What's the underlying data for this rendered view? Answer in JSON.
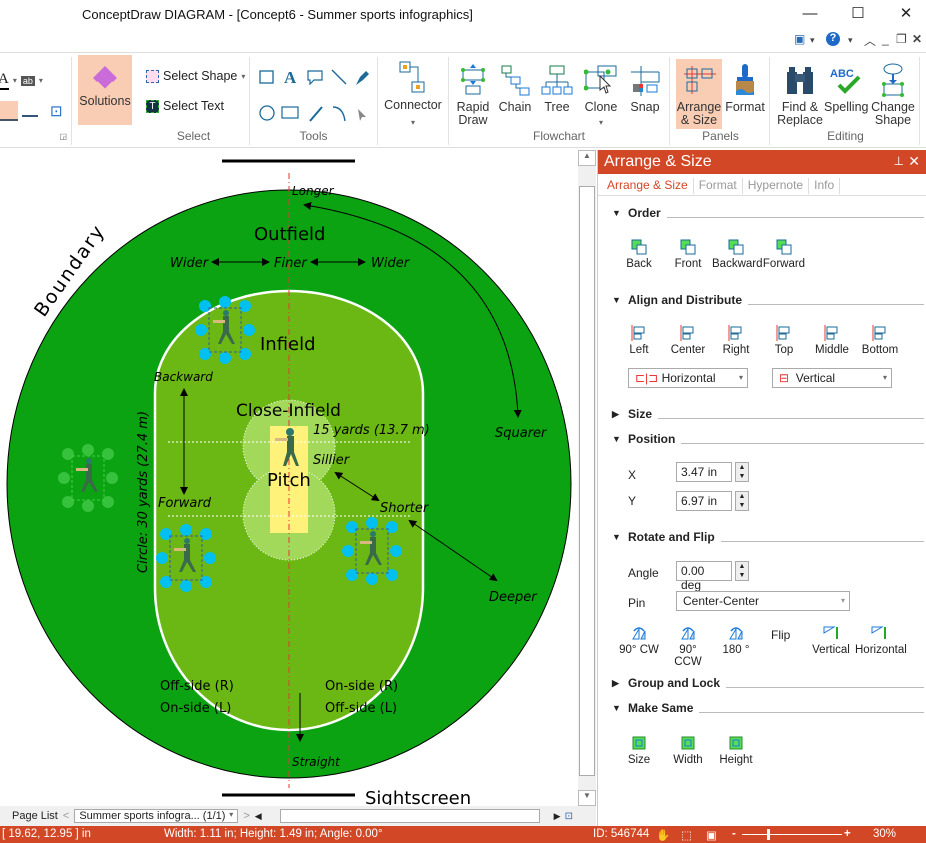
{
  "window": {
    "title": "ConceptDraw DIAGRAM - [Concept6 - Summer sports infographics]",
    "minimize": "—",
    "maximize": "☐",
    "close": "✕"
  },
  "mdi": {
    "layout_icon": "▣",
    "help_icon": "?",
    "collapse": "︿",
    "min": "_",
    "restore": "❐",
    "close": "✕",
    "dropdown": "▾"
  },
  "ribbon": {
    "format_small": {
      "font_color": "A",
      "highlight": "ab"
    },
    "solutions": {
      "label": "Solutions"
    },
    "select": {
      "select_shape": "Select Shape",
      "select_text": "Select Text",
      "group": "Select"
    },
    "tools": {
      "group": "Tools"
    },
    "connector": {
      "label": "Connector"
    },
    "flowchart": {
      "group": "Flowchart",
      "items": [
        {
          "label": "Rapid\nDraw"
        },
        {
          "label": "Chain"
        },
        {
          "label": "Tree"
        },
        {
          "label": "Clone"
        },
        {
          "label": "Snap"
        }
      ]
    },
    "panels": {
      "group": "Panels",
      "arrange": "Arrange\n& Size",
      "format": "Format"
    },
    "editing": {
      "group": "Editing",
      "find": "Find &\nReplace",
      "spelling": "Spelling",
      "change": "Change\nShape"
    }
  },
  "canvas": {
    "labels": {
      "boundary": "Boundary",
      "outfield": "Outfield",
      "infield": "Infield",
      "close_infield": "Close-Infield",
      "pitch": "Pitch",
      "longer": "Longer",
      "wider_left": "Wider",
      "finer": "Finer",
      "wider_right": "Wider",
      "squarer": "Squarer",
      "backward": "Backward",
      "forward": "Forward",
      "fifteen": "15 yards (13.7 m)",
      "sillier": "Sillier",
      "shorter": "Shorter",
      "deeper": "Deeper",
      "circle": "Circle: 30 yards (27.4 m)",
      "offside_r": "Off-side (R)",
      "onside_l": "On-side (L)",
      "onside_r": "On-side (R)",
      "offside_l": "Off-side (L)",
      "straight": "Straight",
      "sightscreen": "Sightscreen"
    },
    "colors": {
      "outfield": "#0ba312",
      "infield": "#6bb814",
      "close": "#a3d95a",
      "pitch": "#fff27a",
      "handle": "#00c0f0"
    }
  },
  "pagelist": {
    "label": "Page List",
    "page": "Summer sports infogra... (1/1)"
  },
  "panel": {
    "title": "Arrange & Size",
    "pin": "📌",
    "close": "✕",
    "tabs": [
      "Arrange & Size",
      "Format",
      "Hypernote",
      "Info"
    ],
    "order": {
      "title": "Order",
      "items": [
        "Back",
        "Front",
        "Backward",
        "Forward"
      ]
    },
    "align": {
      "title": "Align and Distribute",
      "items": [
        "Left",
        "Center",
        "Right",
        "Top",
        "Middle",
        "Bottom"
      ],
      "horizontal": "Horizontal",
      "vertical": "Vertical"
    },
    "size": {
      "title": "Size"
    },
    "position": {
      "title": "Position",
      "x_label": "X",
      "x_value": "3.47 in",
      "y_label": "Y",
      "y_value": "6.97 in"
    },
    "rotate": {
      "title": "Rotate and Flip",
      "angle_label": "Angle",
      "angle_value": "0.00 deg",
      "pin_label": "Pin",
      "pin_value": "Center-Center",
      "items": [
        "90° CW",
        "90° CCW",
        "180 °"
      ],
      "flip": "Flip",
      "flip_items": [
        "Vertical",
        "Horizontal"
      ]
    },
    "group": {
      "title": "Group and Lock"
    },
    "make_same": {
      "title": "Make Same",
      "items": [
        "Size",
        "Width",
        "Height"
      ]
    }
  },
  "status": {
    "coords": "[ 19.62, 12.95 ] in",
    "dims": "Width: 1.11 in;  Height: 1.49 in;  Angle: 0.00°",
    "id": "ID: 546744",
    "zoom": "30%",
    "zoom_level_percent": 30
  }
}
